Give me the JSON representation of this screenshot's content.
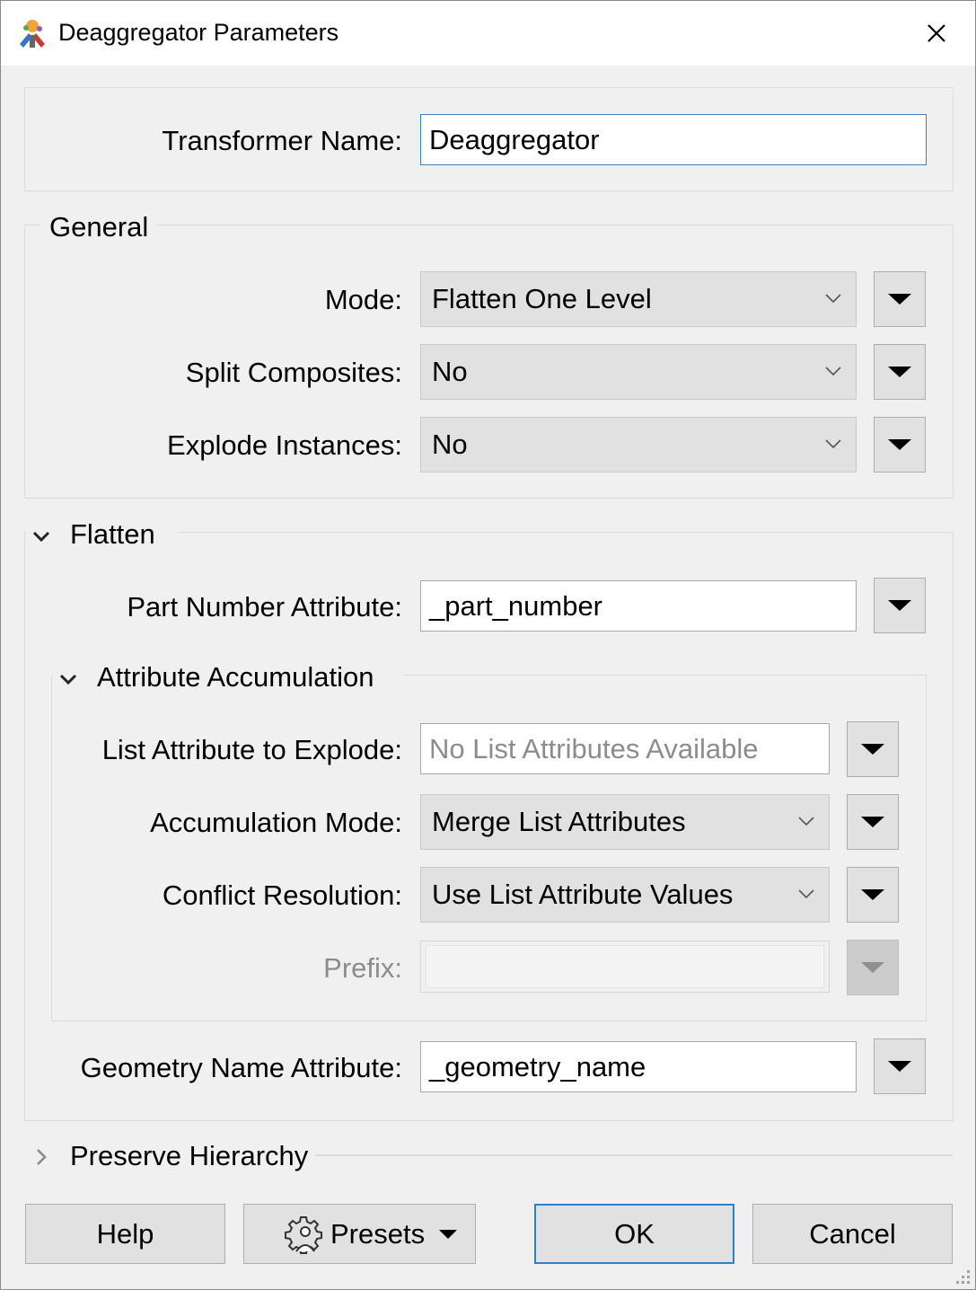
{
  "window": {
    "title": "Deaggregator Parameters",
    "app_icon": "fme-transformer-icon",
    "close_icon": "close-icon"
  },
  "transformer": {
    "name_label": "Transformer Name:",
    "name_value": "Deaggregator"
  },
  "general": {
    "title": "General",
    "mode": {
      "label": "Mode:",
      "value": "Flatten One Level"
    },
    "split_composites": {
      "label": "Split Composites:",
      "value": "No"
    },
    "explode_instances": {
      "label": "Explode Instances:",
      "value": "No"
    }
  },
  "flatten": {
    "title": "Flatten",
    "expanded": true,
    "part_number": {
      "label": "Part Number Attribute:",
      "value": "_part_number"
    },
    "attribute_accumulation": {
      "title": "Attribute Accumulation",
      "expanded": true,
      "list_attribute": {
        "label": "List Attribute to Explode:",
        "placeholder": "No List Attributes Available"
      },
      "accumulation_mode": {
        "label": "Accumulation Mode:",
        "value": "Merge List Attributes"
      },
      "conflict_resolution": {
        "label": "Conflict Resolution:",
        "value": "Use List Attribute Values"
      },
      "prefix": {
        "label": "Prefix:",
        "value": "",
        "disabled": true
      }
    },
    "geometry_name": {
      "label": "Geometry Name Attribute:",
      "value": "_geometry_name"
    }
  },
  "preserve_hierarchy": {
    "title": "Preserve Hierarchy",
    "expanded": false
  },
  "buttons": {
    "help": "Help",
    "presets": "Presets",
    "ok": "OK",
    "cancel": "Cancel"
  },
  "colors": {
    "focus_border": "#3c7fc1",
    "default_button_border": "#2f7fd0",
    "combo_bg": "#e1e1e1",
    "disabled_text": "#8c8c8c"
  }
}
